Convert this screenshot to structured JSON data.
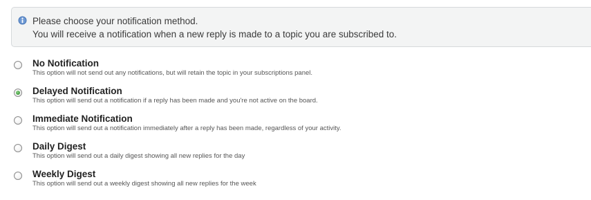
{
  "info": {
    "icon": "info-icon",
    "line1": "Please choose your notification method.",
    "line2": "You will receive a notification when a new reply is made to a topic you are subscribed to."
  },
  "options": [
    {
      "title": "No Notification",
      "description": "This option will not send out any notifications, but will retain the topic in your subscriptions panel.",
      "checked": false
    },
    {
      "title": "Delayed Notification",
      "description": "This option will send out a notification if a reply has been made and you're not active on the board.",
      "checked": true
    },
    {
      "title": "Immediate Notification",
      "description": "This option will send out a notification immediately after a reply has been made, regardless of your activity.",
      "checked": false
    },
    {
      "title": "Daily Digest",
      "description": "This option will send out a daily digest showing all new replies for the day",
      "checked": false
    },
    {
      "title": "Weekly Digest",
      "description": "This option will send out a weekly digest showing all new replies for the week",
      "checked": false
    }
  ],
  "colors": {
    "info_icon": "#4a78b8",
    "checked_dot": "#3e9a3a"
  }
}
